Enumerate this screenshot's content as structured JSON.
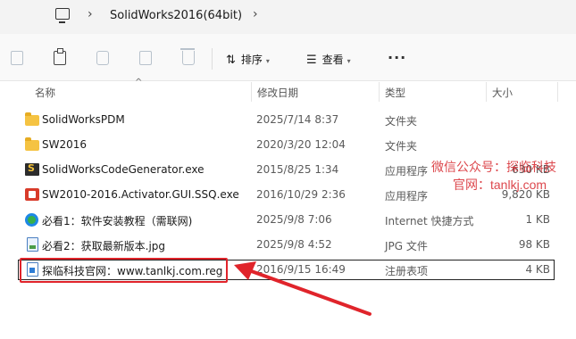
{
  "address_bar": {
    "path": "SolidWorks2016(64bit)"
  },
  "toolbar": {
    "sort_label": "排序",
    "view_label": "查看",
    "more_label": "···"
  },
  "columns": {
    "name": "名称",
    "date": "修改日期",
    "type": "类型",
    "size": "大小"
  },
  "files": [
    {
      "name": "SolidWorksPDM",
      "date": "2025/7/14 8:37",
      "type": "文件夹",
      "size": "",
      "icon": "folder-icon"
    },
    {
      "name": "SW2016",
      "date": "2020/3/20 12:04",
      "type": "文件夹",
      "size": "",
      "icon": "folder-icon"
    },
    {
      "name": "SolidWorksCodeGenerator.exe",
      "date": "2015/8/25 1:34",
      "type": "应用程序",
      "size": "630 KB",
      "icon": "exe-icon"
    },
    {
      "name": "SW2010-2016.Activator.GUI.SSQ.exe",
      "date": "2016/10/29 2:36",
      "type": "应用程序",
      "size": "9,820 KB",
      "icon": "exe-icon"
    },
    {
      "name": "必看1：软件安装教程（需联网)",
      "date": "2025/9/8 7:06",
      "type": "Internet 快捷方式",
      "size": "1 KB",
      "icon": "internet-shortcut-icon"
    },
    {
      "name": "必看2：获取最新版本.jpg",
      "date": "2025/9/8 4:52",
      "type": "JPG 文件",
      "size": "98 KB",
      "icon": "jpg-file-icon"
    },
    {
      "name": "探临科技官网：www.tanlkj.com.reg",
      "date": "2016/9/15 16:49",
      "type": "注册表项",
      "size": "4 KB",
      "icon": "reg-file-icon"
    }
  ],
  "watermark": {
    "line1": "微信公众号：探临科技",
    "line2": "官网：tanlkj.com"
  },
  "colors": {
    "highlight_box": "#e0242b",
    "arrow": "#e0242b",
    "watermark": "#d7272d"
  }
}
